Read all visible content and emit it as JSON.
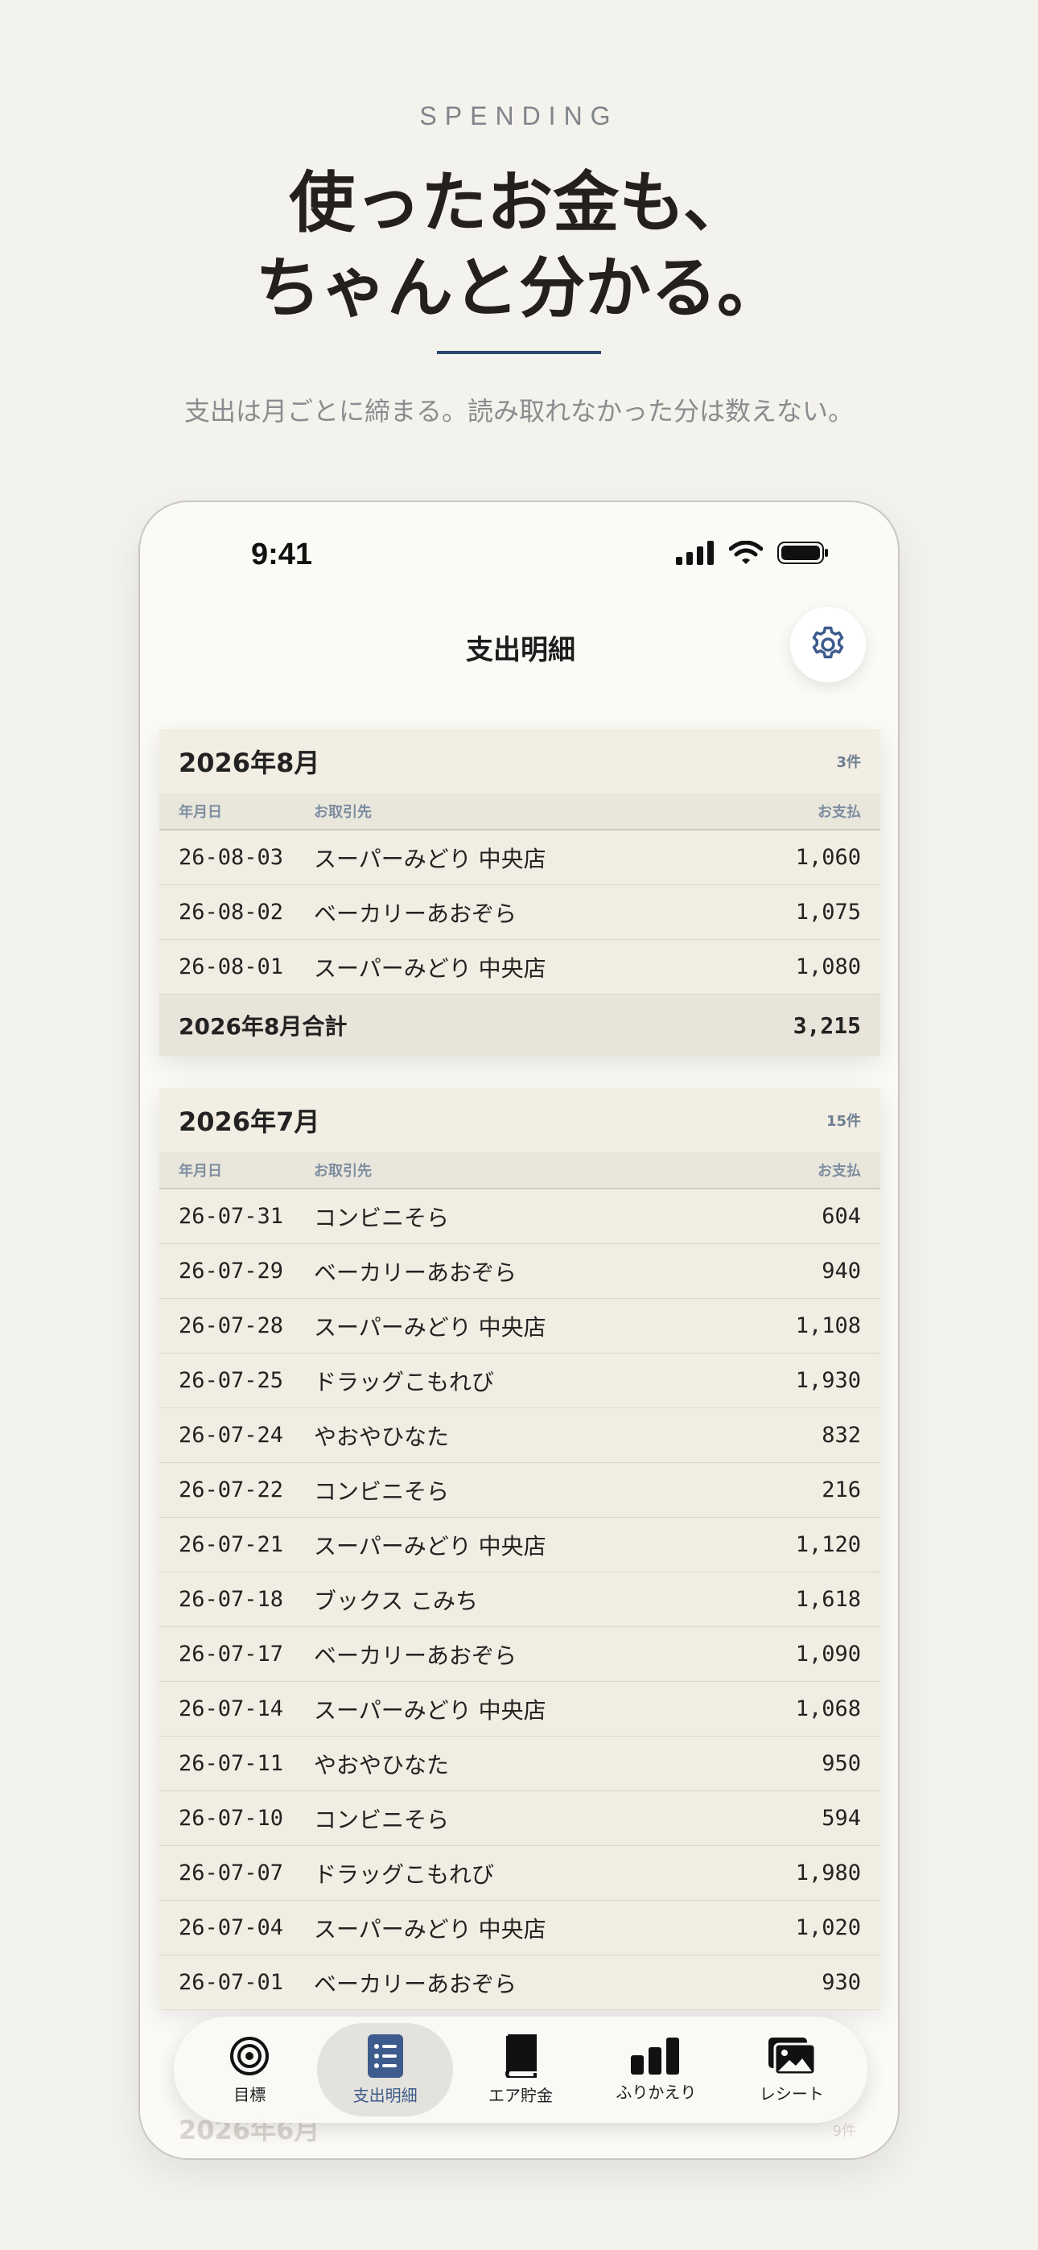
{
  "hero": {
    "eyebrow": "SPENDING",
    "headline_line1": "使ったお金も、",
    "headline_line2": "ちゃんと分かる。",
    "subtitle": "支出は月ごとに締まる。読み取れなかった分は数えない。"
  },
  "status_bar": {
    "time": "9:41"
  },
  "nav": {
    "title": "支出明細",
    "settings_icon": "gear-icon"
  },
  "columns": {
    "date": "年月日",
    "shop": "お取引先",
    "amount": "お支払"
  },
  "months": [
    {
      "title": "2026年8月",
      "count": "3件",
      "rows": [
        {
          "date": "26-08-03",
          "shop": "スーパーみどり 中央店",
          "amount": "1,060"
        },
        {
          "date": "26-08-02",
          "shop": "ベーカリーあおぞら",
          "amount": "1,075"
        },
        {
          "date": "26-08-01",
          "shop": "スーパーみどり 中央店",
          "amount": "1,080"
        }
      ],
      "total_label": "2026年8月合計",
      "total_amount": "3,215"
    },
    {
      "title": "2026年7月",
      "count": "15件",
      "rows": [
        {
          "date": "26-07-31",
          "shop": "コンビニそら",
          "amount": "604"
        },
        {
          "date": "26-07-29",
          "shop": "ベーカリーあおぞら",
          "amount": "940"
        },
        {
          "date": "26-07-28",
          "shop": "スーパーみどり 中央店",
          "amount": "1,108"
        },
        {
          "date": "26-07-25",
          "shop": "ドラッグこもれび",
          "amount": "1,930"
        },
        {
          "date": "26-07-24",
          "shop": "やおやひなた",
          "amount": "832"
        },
        {
          "date": "26-07-22",
          "shop": "コンビニそら",
          "amount": "216"
        },
        {
          "date": "26-07-21",
          "shop": "スーパーみどり 中央店",
          "amount": "1,120"
        },
        {
          "date": "26-07-18",
          "shop": "ブックス こみち",
          "amount": "1,618"
        },
        {
          "date": "26-07-17",
          "shop": "ベーカリーあおぞら",
          "amount": "1,090"
        },
        {
          "date": "26-07-14",
          "shop": "スーパーみどり 中央店",
          "amount": "1,068"
        },
        {
          "date": "26-07-11",
          "shop": "やおやひなた",
          "amount": "950"
        },
        {
          "date": "26-07-10",
          "shop": "コンビニそら",
          "amount": "594"
        },
        {
          "date": "26-07-07",
          "shop": "ドラッグこもれび",
          "amount": "1,980"
        },
        {
          "date": "26-07-04",
          "shop": "スーパーみどり 中央店",
          "amount": "1,020"
        },
        {
          "date": "26-07-01",
          "shop": "ベーカリーあおぞら",
          "amount": "930"
        }
      ]
    },
    {
      "title": "2026年6月",
      "count": "9件"
    }
  ],
  "tabbar": [
    {
      "label": "目標",
      "icon": "target-icon"
    },
    {
      "label": "支出明細",
      "icon": "list-icon",
      "active": true
    },
    {
      "label": "エア貯金",
      "icon": "book-icon"
    },
    {
      "label": "ふりかえり",
      "icon": "bar-chart-icon"
    },
    {
      "label": "レシート",
      "icon": "photos-icon"
    }
  ],
  "colors": {
    "accent": "#3d5b8c",
    "background": "#f4f2ec",
    "card": "#f1ede2"
  }
}
